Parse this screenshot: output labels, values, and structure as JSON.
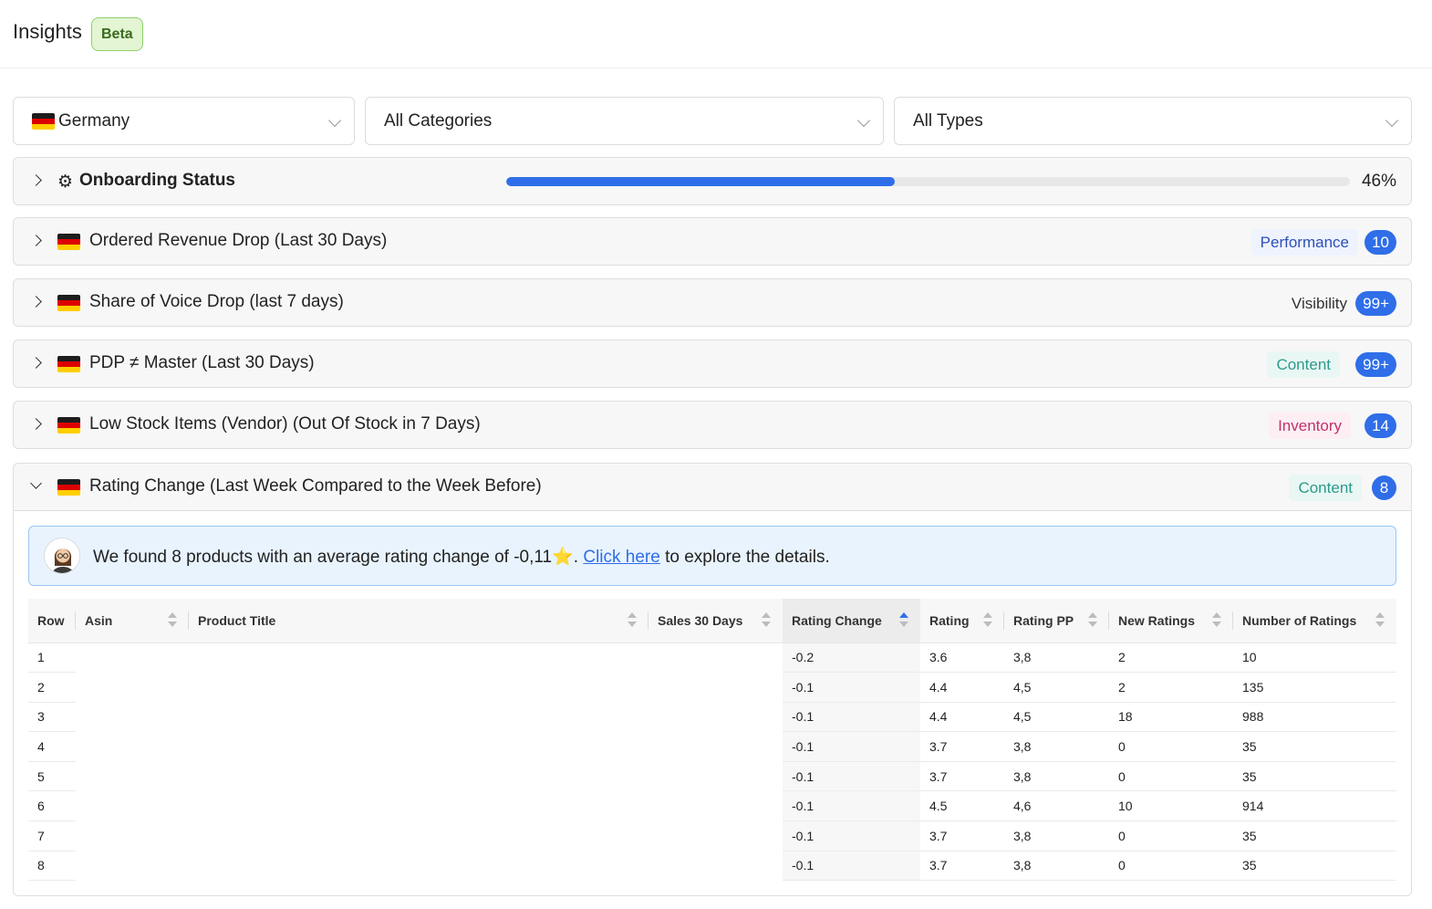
{
  "header": {
    "title": "Insights",
    "badge": "Beta"
  },
  "filters": {
    "country": "Germany",
    "category": "All Categories",
    "type": "All Types"
  },
  "onboarding": {
    "title": "Onboarding Status",
    "progress_percent": 46,
    "progress_label": "46%"
  },
  "insights": [
    {
      "title": "Ordered Revenue Drop (Last 30 Days)",
      "tag": "Performance",
      "count": "10",
      "expanded": false
    },
    {
      "title": "Share of Voice Drop (last 7 days)",
      "tag": "Visibility",
      "count": "99+",
      "expanded": false
    },
    {
      "title": "PDP ≠ Master (Last 30 Days)",
      "tag": "Content",
      "count": "99+",
      "expanded": false
    },
    {
      "title": "Low Stock Items (Vendor) (Out Of Stock in 7 Days)",
      "tag": "Inventory",
      "count": "14",
      "expanded": false
    },
    {
      "title": "Rating Change (Last Week Compared to the Week Before)",
      "tag": "Content",
      "count": "8",
      "expanded": true
    }
  ],
  "rating_panel": {
    "message_pre": "We found 8 products with an average rating change of -0,11⭐. ",
    "link_text": "Click here",
    "message_post": " to explore the details.",
    "columns": [
      "Row",
      "Asin",
      "Product Title",
      "Sales 30 Days",
      "Rating Change",
      "Rating",
      "Rating PP",
      "New Ratings",
      "Number of Ratings"
    ],
    "sorted_column": "Rating Change",
    "rows": [
      [
        "1",
        "",
        "",
        "",
        "-0.2",
        "3.6",
        "3,8",
        "2",
        "10"
      ],
      [
        "2",
        "",
        "",
        "",
        "-0.1",
        "4.4",
        "4,5",
        "2",
        "135"
      ],
      [
        "3",
        "",
        "",
        "",
        "-0.1",
        "4.4",
        "4,5",
        "18",
        "988"
      ],
      [
        "4",
        "",
        "",
        "",
        "-0.1",
        "3.7",
        "3,8",
        "0",
        "35"
      ],
      [
        "5",
        "",
        "",
        "",
        "-0.1",
        "3.7",
        "3,8",
        "0",
        "35"
      ],
      [
        "6",
        "",
        "",
        "",
        "-0.1",
        "4.5",
        "4,6",
        "10",
        "914"
      ],
      [
        "7",
        "",
        "",
        "",
        "-0.1",
        "3.7",
        "3,8",
        "0",
        "35"
      ],
      [
        "8",
        "",
        "",
        "",
        "-0.1",
        "3.7",
        "3,8",
        "0",
        "35"
      ]
    ]
  },
  "colors": {
    "accent": "#2f6ee8",
    "tag_performance_bg": "#eef3fe",
    "tag_performance_fg": "#2f4fb8",
    "tag_visibility_bg": "transparent",
    "tag_visibility_fg": "#333333",
    "tag_content_bg": "#e9f7f4",
    "tag_content_fg": "#2a9a8a",
    "tag_inventory_bg": "#fdeef4",
    "tag_inventory_fg": "#c2306b"
  },
  "icons": {
    "onboarding": "gear-icon",
    "country": "germany-flag-icon",
    "avatar": "assistant-avatar-icon"
  }
}
